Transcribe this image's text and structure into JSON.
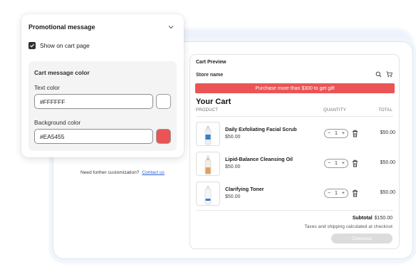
{
  "panel": {
    "title": "Promotional message",
    "show_on_cart_label": "Show on cart page",
    "show_on_cart_checked": true,
    "color_section_title": "Cart message color",
    "text_color_label": "Text color",
    "text_color_value": "#FFFFFF",
    "background_color_label": "Background color",
    "background_color_value": "#EA5455"
  },
  "customization": {
    "text": "Need further customization?",
    "link": "Contact us"
  },
  "preview": {
    "title": "Cart Preview",
    "store_name": "Store name",
    "promo_message": "Purchase more than $300 to get gift",
    "cart_title": "Your Cart",
    "columns": {
      "product": "PRODUCT",
      "quantity": "QUANTITY",
      "total": "TOTAL"
    },
    "items": [
      {
        "name": "Daily Exfoliating Facial Scrub",
        "price": "$50.00",
        "qty": "1",
        "total": "$50.00"
      },
      {
        "name": "Lipid-Balance Cleansing Oil",
        "price": "$50.00",
        "qty": "1",
        "total": "$50.00"
      },
      {
        "name": "Clarifying Toner",
        "price": "$50.00",
        "qty": "1",
        "total": "$50.00"
      }
    ],
    "subtotal_label": "Subtotal",
    "subtotal_value": "$150.00",
    "taxes_note": "Taxes and shipping calculated at checkout",
    "checkout_label": "Checkout"
  },
  "icons": {
    "minus": "−",
    "plus": "+"
  },
  "colors": {
    "promo_text": "#FFFFFF",
    "promo_background": "#EA5455",
    "link": "#2F5ED8"
  }
}
